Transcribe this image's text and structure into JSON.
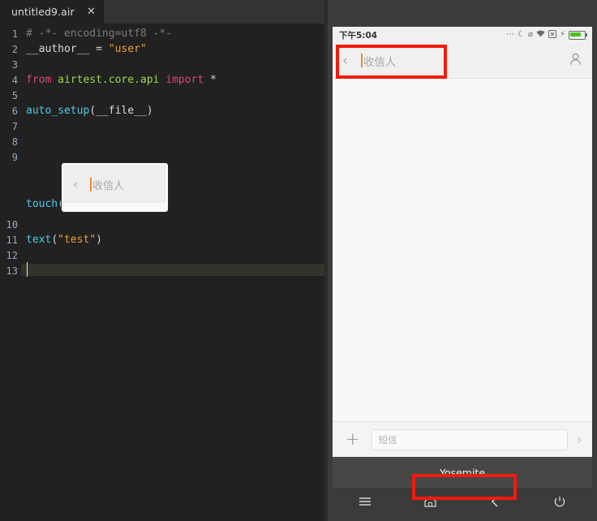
{
  "editor": {
    "tab": {
      "label": "untitled9.air",
      "close_icon": "close-icon"
    },
    "lines": [
      {
        "n": "1",
        "segments": [
          {
            "t": "# -*- encoding=utf8 -*-",
            "c": "tok-comment"
          }
        ]
      },
      {
        "n": "2",
        "segments": [
          {
            "t": "__author__",
            "c": "tok-dunder"
          },
          {
            "t": " = ",
            "c": "tok-op"
          },
          {
            "t": "\"user\"",
            "c": "tok-str"
          }
        ]
      },
      {
        "n": "3",
        "segments": []
      },
      {
        "n": "4",
        "segments": [
          {
            "t": "from ",
            "c": "tok-kw"
          },
          {
            "t": "airtest.core.api",
            "c": "tok-mod"
          },
          {
            "t": " import ",
            "c": "tok-kw"
          },
          {
            "t": "*",
            "c": "tok-op"
          }
        ]
      },
      {
        "n": "5",
        "segments": []
      },
      {
        "n": "6",
        "segments": [
          {
            "t": "auto_setup",
            "c": "tok-fn"
          },
          {
            "t": "(",
            "c": "tok-paren"
          },
          {
            "t": "__file__",
            "c": "tok-dunder"
          },
          {
            "t": ")",
            "c": "tok-paren"
          }
        ]
      },
      {
        "n": "7",
        "segments": []
      },
      {
        "n": "8",
        "segments": []
      },
      {
        "n": "9",
        "segments": [
          {
            "t": "touch",
            "c": "tok-fn"
          },
          {
            "t": "(",
            "c": "tok-paren"
          }
        ]
      },
      {
        "n": "10",
        "segments": []
      },
      {
        "n": "11",
        "segments": [
          {
            "t": "text",
            "c": "tok-fn"
          },
          {
            "t": "(",
            "c": "tok-paren"
          },
          {
            "t": "\"test\"",
            "c": "tok-str"
          },
          {
            "t": ")",
            "c": "tok-paren"
          }
        ]
      },
      {
        "n": "12",
        "segments": []
      },
      {
        "n": "13",
        "segments": []
      }
    ],
    "touch_close_paren": ")",
    "inline_image": {
      "back_icon": "chevron-left-icon",
      "placeholder": "收信人"
    }
  },
  "device": {
    "status_bar": {
      "time": "下午5:04",
      "icons": [
        {
          "name": "more-dots-icon",
          "glyph": "•••"
        },
        {
          "name": "do-not-disturb-moon-icon",
          "glyph": "☾"
        },
        {
          "name": "mute-bell-icon",
          "glyph": "⌀"
        },
        {
          "name": "wifi-icon",
          "glyph": "◠"
        },
        {
          "name": "sim-signal-icon",
          "glyph": "⊠"
        },
        {
          "name": "charging-bolt-icon",
          "glyph": "⚡"
        }
      ],
      "battery": {
        "name": "battery-icon",
        "level_percent": 85,
        "color": "#4cc21c"
      }
    },
    "recipient_bar": {
      "back_icon": "chevron-left-icon",
      "placeholder": "收信人",
      "contact_icon": "person-icon"
    },
    "compose_bar": {
      "plus_icon": "plus-icon",
      "input_placeholder": "短信",
      "input_value": "",
      "send_icon": "chevron-right-icon"
    },
    "yosemite_strip": {
      "label": "Yosemite"
    },
    "nav_bar": [
      {
        "name": "nav-menu-button",
        "icon": "hamburger-menu-icon",
        "glyph": "☰"
      },
      {
        "name": "nav-home-button",
        "icon": "home-icon",
        "glyph": "⌂"
      },
      {
        "name": "nav-back-button",
        "icon": "chevron-left-icon",
        "glyph": "‹"
      },
      {
        "name": "nav-power-button",
        "icon": "power-icon",
        "glyph": "⏻"
      }
    ]
  },
  "annotations": {
    "color": "#f11b0e",
    "boxes": [
      {
        "name": "highlight-recipient-field",
        "target": "recipient_bar"
      },
      {
        "name": "highlight-yosemite-label",
        "target": "yosemite_strip"
      }
    ]
  }
}
